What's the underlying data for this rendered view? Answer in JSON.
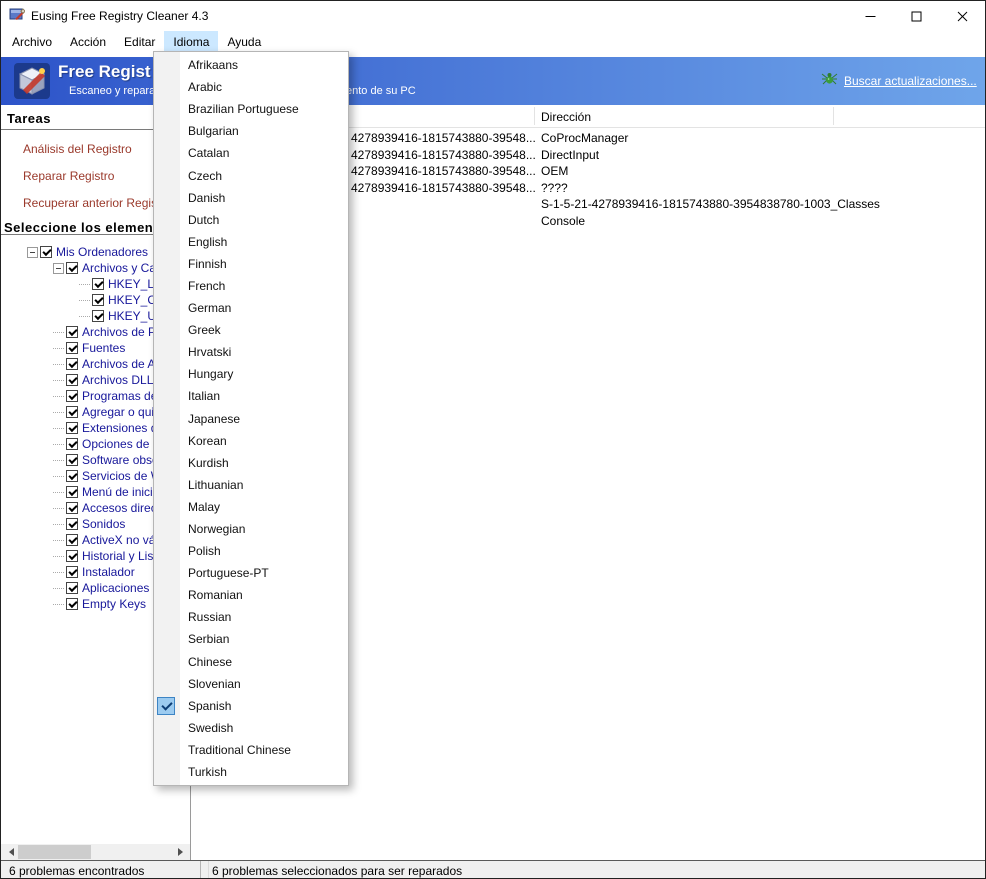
{
  "colors": {
    "banner_left": "#2d54c9",
    "banner_right": "#6fa5ea",
    "menu_highlight_bg": "#cce8ff",
    "task_link": "#9a392b",
    "tree_text": "#17179a",
    "check_bg": "#9ccbf0",
    "check_border": "#3d84c4"
  },
  "titlebar": {
    "title": "Eusing Free Registry Cleaner 4.3"
  },
  "menubar": {
    "items": [
      {
        "label": "Archivo",
        "active": false
      },
      {
        "label": "Acción",
        "active": false
      },
      {
        "label": "Editar",
        "active": false
      },
      {
        "label": "Idioma",
        "active": true
      },
      {
        "label": "Ayuda",
        "active": false
      }
    ]
  },
  "language_menu": {
    "selected": "Spanish",
    "items": [
      "Afrikaans",
      "Arabic",
      "Brazilian Portuguese",
      "Bulgarian",
      "Catalan",
      "Czech",
      "Danish",
      "Dutch",
      "English",
      "Finnish",
      "French",
      "German",
      "Greek",
      "Hrvatski",
      "Hungary",
      "Italian",
      "Japanese",
      "Korean",
      "Kurdish",
      "Lithuanian",
      "Malay",
      "Norwegian",
      "Polish",
      "Portuguese-PT",
      "Romanian",
      "Russian",
      "Serbian",
      "Chinese",
      "Slovenian",
      "Spanish",
      "Swedish",
      "Traditional Chinese",
      "Turkish"
    ]
  },
  "banner": {
    "title_fragment": "Free Regist",
    "subtitle_left_fragment": "Escaneo y reparaci",
    "subtitle_right_fragment": "ento de su PC",
    "update_link": "Buscar actualizaciones..."
  },
  "sidebar": {
    "tasks_header": "Tareas",
    "tasks": [
      {
        "label": "Análisis del Registro"
      },
      {
        "label": "Reparar Registro"
      },
      {
        "label": "Recuperar anterior Registr"
      }
    ],
    "select_header": "Seleccione los elemen",
    "tree": {
      "label": "Mis Ordenadores",
      "checked": true,
      "expanded": true,
      "children": [
        {
          "label": "Archivos y Carp",
          "checked": true,
          "expanded": true,
          "children": [
            {
              "label": "HKEY_LO",
              "checked": true
            },
            {
              "label": "HKEY_CU",
              "checked": true
            },
            {
              "label": "HKEY_US",
              "checked": true
            }
          ]
        },
        {
          "label": "Archivos de Pr",
          "checked": true
        },
        {
          "label": "Fuentes",
          "checked": true
        },
        {
          "label": "Archivos de Ay",
          "checked": true
        },
        {
          "label": "Archivos DLL c",
          "checked": true
        },
        {
          "label": "Programas de i",
          "checked": true
        },
        {
          "label": "Agregar o quita",
          "checked": true
        },
        {
          "label": "Extensiones de",
          "checked": true
        },
        {
          "label": "Opciones de C",
          "checked": true
        },
        {
          "label": "Software obsol",
          "checked": true
        },
        {
          "label": "Servicios de W",
          "checked": true
        },
        {
          "label": "Menú de inicio",
          "checked": true
        },
        {
          "label": "Accesos direct",
          "checked": true
        },
        {
          "label": "Sonidos",
          "checked": true
        },
        {
          "label": "ActiveX no váli",
          "checked": true
        },
        {
          "label": "Historial y Lista",
          "checked": true
        },
        {
          "label": "Instalador",
          "checked": true
        },
        {
          "label": "Aplicaciones",
          "checked": true
        },
        {
          "label": "Empty Keys",
          "checked": true
        }
      ]
    }
  },
  "results": {
    "header_direccion": "Dirección",
    "rows": [
      {
        "path_fragment": "4278939416-1815743880-39548...",
        "direccion": "CoProcManager"
      },
      {
        "path_fragment": "4278939416-1815743880-39548...",
        "direccion": "DirectInput"
      },
      {
        "path_fragment": "4278939416-1815743880-39548...",
        "direccion": "OEM"
      },
      {
        "path_fragment": "4278939416-1815743880-39548...",
        "direccion": "????"
      },
      {
        "path_fragment": "",
        "direccion": "S-1-5-21-4278939416-1815743880-3954838780-1003_Classes"
      },
      {
        "path_fragment": "",
        "direccion": "Console"
      }
    ]
  },
  "statusbar": {
    "left": "6 problemas encontrados",
    "right": "6 problemas seleccionados para ser reparados"
  }
}
